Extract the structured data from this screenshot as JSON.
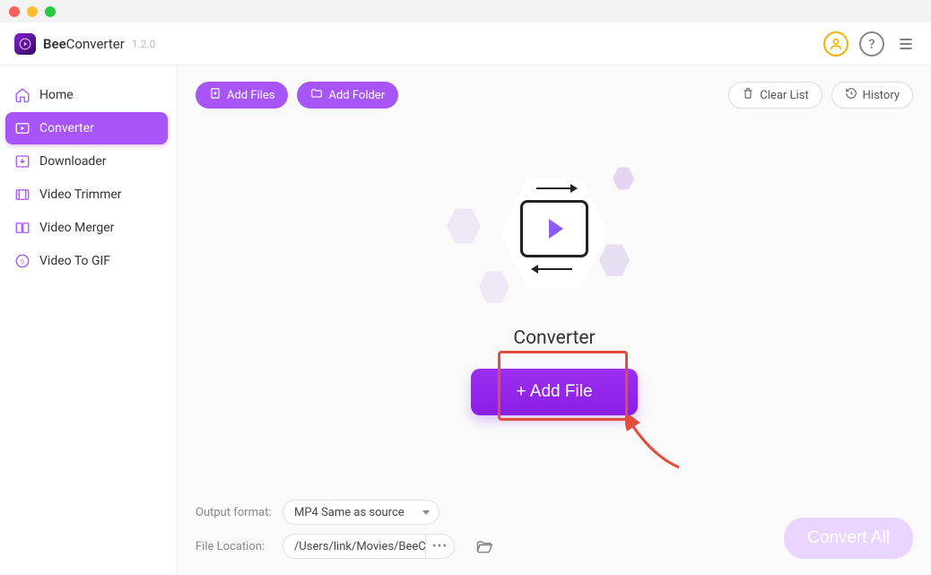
{
  "app": {
    "name_bold": "Bee",
    "name_rest": "Converter",
    "version": "1.2.0"
  },
  "sidebar": {
    "items": [
      {
        "label": "Home"
      },
      {
        "label": "Converter"
      },
      {
        "label": "Downloader"
      },
      {
        "label": "Video Trimmer"
      },
      {
        "label": "Video Merger"
      },
      {
        "label": "Video To GIF"
      }
    ]
  },
  "toolbar": {
    "add_files": "Add Files",
    "add_folder": "Add Folder",
    "clear_list": "Clear List",
    "history": "History"
  },
  "center": {
    "title": "Converter",
    "add_file_btn": "+ Add File"
  },
  "bottom": {
    "output_label": "Output format:",
    "output_value": "MP4 Same as source",
    "location_label": "File Location:",
    "location_value": "/Users/link/Movies/BeeC",
    "convert_all": "Convert All"
  }
}
